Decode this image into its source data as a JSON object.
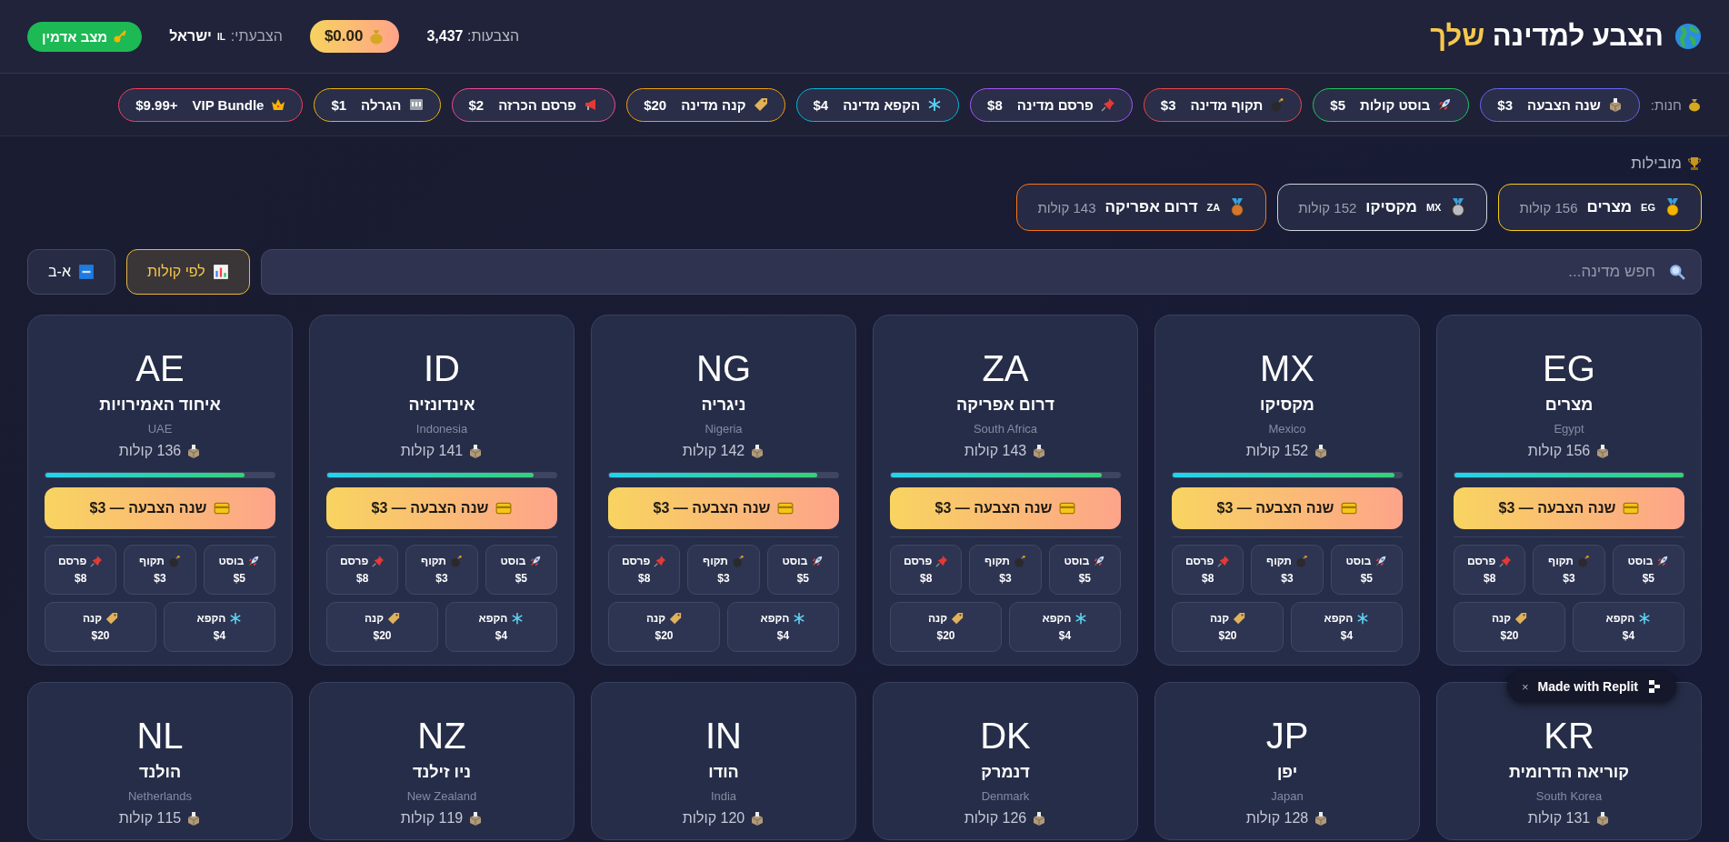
{
  "header": {
    "title": "הצבע למדינה",
    "title_highlight": "שלך",
    "total_votes": "הצבעות: **3,437**",
    "balance": "$0.00",
    "my_vote": {
      "label": "הצבעתי:",
      "flag": "IL",
      "country": "ישראל"
    },
    "admin_button": "מצב אדמין"
  },
  "shop": {
    "label": "חנות:",
    "items": [
      {
        "kind": "ballot",
        "label": "שנה הצבעה",
        "price": "$3",
        "color": "#6366f1"
      },
      {
        "kind": "rocket",
        "label": "בוסט קולות",
        "price": "$5",
        "color": "#22c55e"
      },
      {
        "kind": "bomb",
        "label": "תקוף מדינה",
        "price": "$3",
        "color": "#ef4444"
      },
      {
        "kind": "pin",
        "label": "פרסם מדינה",
        "price": "$8",
        "color": "#a855f7"
      },
      {
        "kind": "snowflake",
        "label": "הקפא מדינה",
        "price": "$4",
        "color": "#06b6d4"
      },
      {
        "kind": "tag",
        "label": "קנה מדינה",
        "price": "$20",
        "color": "#f59e0b"
      },
      {
        "kind": "megaphone",
        "label": "פרסם הכרזה",
        "price": "$2",
        "color": "#ec4899"
      },
      {
        "kind": "slot",
        "label": "הגרלה",
        "price": "$1",
        "color": "#eab308"
      },
      {
        "kind": "crown",
        "label": "VIP Bundle",
        "price": "$9.99+",
        "color": "#f43f5e"
      }
    ]
  },
  "leaders": {
    "title": "מובילות",
    "items": [
      {
        "code": "EG",
        "name": "מצרים",
        "votes": "156 קולות",
        "color": "#facc15"
      },
      {
        "code": "MX",
        "name": "מקסיקו",
        "votes": "152 קולות",
        "color": "#cbd5e1"
      },
      {
        "code": "ZA",
        "name": "דרום אפריקה",
        "votes": "143 קולות",
        "color": "#f97316"
      }
    ]
  },
  "search": {
    "placeholder": "חפש מדינה..."
  },
  "sort_buttons": [
    {
      "kind": "chart",
      "label": "לפי קולות",
      "selected": true
    },
    {
      "kind": "abc",
      "label": "א-ב",
      "selected": false
    }
  ],
  "countries": [
    {
      "code": "EG",
      "name": "מצרים",
      "english": "Egypt",
      "votes": "156 קולות",
      "level": 1,
      "cta": "שנה הצבעה — $3",
      "actions": [
        {
          "kind": "rocket",
          "label": "בוסט",
          "price": "$5"
        },
        {
          "kind": "bomb",
          "label": "תקוף",
          "price": "$3"
        },
        {
          "kind": "pin",
          "label": "פרסם",
          "price": "$8"
        },
        {
          "kind": "snowflake",
          "label": "הקפא",
          "price": "$4"
        },
        {
          "kind": "tag",
          "label": "קנה",
          "price": "$20"
        }
      ]
    },
    {
      "code": "MX",
      "name": "מקסיקו",
      "english": "Mexico",
      "votes": "152 קולות",
      "level": 0.97,
      "cta": "שנה הצבעה — $3",
      "actions": [
        {
          "kind": "rocket",
          "label": "בוסט",
          "price": "$5"
        },
        {
          "kind": "bomb",
          "label": "תקוף",
          "price": "$3"
        },
        {
          "kind": "pin",
          "label": "פרסם",
          "price": "$8"
        },
        {
          "kind": "snowflake",
          "label": "הקפא",
          "price": "$4"
        },
        {
          "kind": "tag",
          "label": "קנה",
          "price": "$20"
        }
      ]
    },
    {
      "code": "ZA",
      "name": "דרום אפריקה",
      "english": "South Africa",
      "votes": "143 קולות",
      "level": 0.92,
      "cta": "שנה הצבעה — $3",
      "actions": [
        {
          "kind": "rocket",
          "label": "בוסט",
          "price": "$5"
        },
        {
          "kind": "bomb",
          "label": "תקוף",
          "price": "$3"
        },
        {
          "kind": "pin",
          "label": "פרסם",
          "price": "$8"
        },
        {
          "kind": "snowflake",
          "label": "הקפא",
          "price": "$4"
        },
        {
          "kind": "tag",
          "label": "קנה",
          "price": "$20"
        }
      ]
    },
    {
      "code": "NG",
      "name": "ניגריה",
      "english": "Nigeria",
      "votes": "142 קולות",
      "level": 0.91,
      "cta": "שנה הצבעה — $3",
      "actions": [
        {
          "kind": "rocket",
          "label": "בוסט",
          "price": "$5"
        },
        {
          "kind": "bomb",
          "label": "תקוף",
          "price": "$3"
        },
        {
          "kind": "pin",
          "label": "פרסם",
          "price": "$8"
        },
        {
          "kind": "snowflake",
          "label": "הקפא",
          "price": "$4"
        },
        {
          "kind": "tag",
          "label": "קנה",
          "price": "$20"
        }
      ]
    },
    {
      "code": "ID",
      "name": "אינדונזיה",
      "english": "Indonesia",
      "votes": "141 קולות",
      "level": 0.9,
      "cta": "שנה הצבעה — $3",
      "actions": [
        {
          "kind": "rocket",
          "label": "בוסט",
          "price": "$5"
        },
        {
          "kind": "bomb",
          "label": "תקוף",
          "price": "$3"
        },
        {
          "kind": "pin",
          "label": "פרסם",
          "price": "$8"
        },
        {
          "kind": "snowflake",
          "label": "הקפא",
          "price": "$4"
        },
        {
          "kind": "tag",
          "label": "קנה",
          "price": "$20"
        }
      ]
    },
    {
      "code": "AE",
      "name": "איחוד האמירויות",
      "english": "UAE",
      "votes": "136 קולות",
      "level": 0.87,
      "cta": "שנה הצבעה — $3",
      "actions": [
        {
          "kind": "rocket",
          "label": "בוסט",
          "price": "$5"
        },
        {
          "kind": "bomb",
          "label": "תקוף",
          "price": "$3"
        },
        {
          "kind": "pin",
          "label": "פרסם",
          "price": "$8"
        },
        {
          "kind": "snowflake",
          "label": "הקפא",
          "price": "$4"
        },
        {
          "kind": "tag",
          "label": "קנה",
          "price": "$20"
        }
      ]
    },
    {
      "code": "KR",
      "name": "קוריאה הדרומית",
      "english": "South Korea",
      "votes": "131 קולות"
    },
    {
      "code": "JP",
      "name": "יפן",
      "english": "Japan",
      "votes": "128 קולות"
    },
    {
      "code": "DK",
      "name": "דנמרק",
      "english": "Denmark",
      "votes": "126 קולות"
    },
    {
      "code": "IN",
      "name": "הודו",
      "english": "India",
      "votes": "120 קולות"
    },
    {
      "code": "NZ",
      "name": "ניו זילנד",
      "english": "New Zealand",
      "votes": "119 קולות"
    },
    {
      "code": "NL",
      "name": "הולנד",
      "english": "Netherlands",
      "votes": "115 קולות"
    }
  ],
  "badge": {
    "close": "×",
    "label": "Made with Replit"
  }
}
